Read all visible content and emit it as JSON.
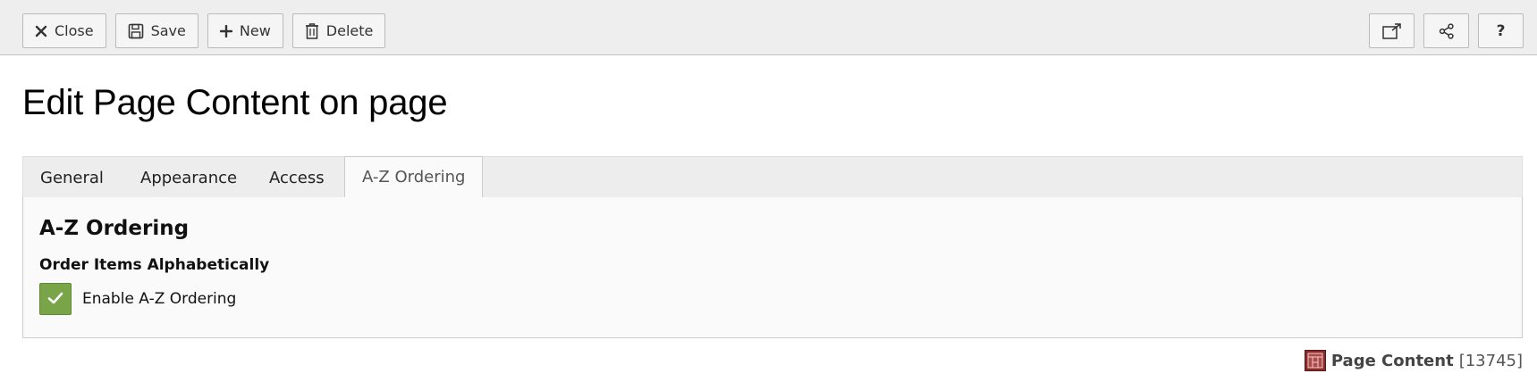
{
  "toolbar": {
    "close_label": "Close",
    "save_label": "Save",
    "new_label": "New",
    "delete_label": "Delete",
    "help_label": "?"
  },
  "page": {
    "title": "Edit Page Content on page"
  },
  "tabs": [
    {
      "label": "General",
      "active": false
    },
    {
      "label": "Appearance",
      "active": false
    },
    {
      "label": "Access",
      "active": false
    },
    {
      "label": "A-Z Ordering",
      "active": true
    }
  ],
  "panel": {
    "heading": "A-Z Ordering",
    "field_label": "Order Items Alphabetically",
    "checkbox_label": "Enable A-Z Ordering",
    "checkbox_checked": true
  },
  "record": {
    "type": "Page Content",
    "id": "[13745]"
  },
  "colors": {
    "checkbox_green": "#79a548",
    "record_icon": "#8a2a2a",
    "toolbar_bg": "#eeeeee"
  }
}
